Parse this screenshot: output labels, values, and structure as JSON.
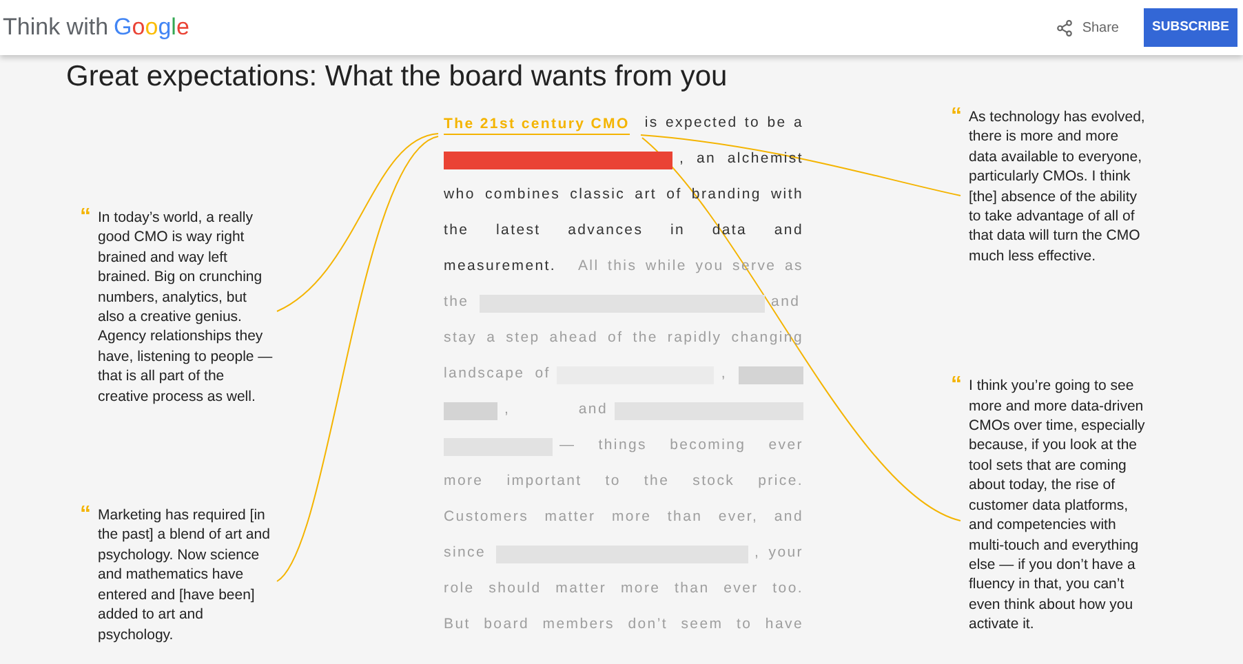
{
  "header": {
    "brand_prefix": "Think with",
    "brand": "Google",
    "share": "Share",
    "subscribe": "SUBSCRIBE"
  },
  "title": "Great expectations: What the board wants from you",
  "left_quotes": [
    {
      "mark": "“",
      "text": "In today’s world, a really good CMO is way right brained and way left brained. Big on crunching numbers, analytics, but also a creative genius. Agency relationships they have, listening to people — that is all part of the creative process as well."
    },
    {
      "mark": "“",
      "text": "Marketing has required [in the past] a blend of art and psychology. Now science and mathematics have entered and [have been] added to art and psychology."
    }
  ],
  "right_quotes": [
    {
      "mark": "“",
      "text": "As technology has evolved, there is more and more data available to everyone, particularly CMOs. I think [the] absence of the ability to take advantage of all of that data will turn the CMO much less effective."
    },
    {
      "mark": "“",
      "text": "I think you’re going to see more and more data-driven CMOs over time, especially because, if you look at the tool sets that are coming about today, the rise of customer data platforms, and competencies with multi-touch and everything else — if you don’t have a fluency in that, you can’t even think about how you activate it."
    }
  ],
  "paragraph": [
    [
      {
        "kind": "link",
        "text": "The 21st century CMO"
      },
      {
        "kind": "text",
        "faded": false,
        "text": "is expected to be a"
      }
    ],
    [
      {
        "kind": "bar",
        "color": "#ea4335"
      },
      {
        "kind": "text",
        "faded": false,
        "text": ", an alchemist"
      }
    ],
    [
      {
        "kind": "text",
        "faded": false,
        "text": "who combines classic art of branding with"
      }
    ],
    [
      {
        "kind": "text",
        "faded": false,
        "text": "the latest advances in data and"
      }
    ],
    [
      {
        "kind": "text",
        "faded": false,
        "text": "measurement."
      },
      {
        "kind": "text",
        "faded": true,
        "text": "All this while you serve as"
      }
    ],
    [
      {
        "kind": "text",
        "faded": true,
        "text": "the"
      },
      {
        "kind": "bar",
        "color": "#e2e2e2"
      },
      {
        "kind": "text",
        "faded": true,
        "text": "and"
      }
    ],
    [
      {
        "kind": "text",
        "faded": true,
        "text": "stay a step ahead of the rapidly changing"
      }
    ],
    [
      {
        "kind": "text",
        "faded": true,
        "text": "landscape of"
      },
      {
        "kind": "bar",
        "color": "#ebebeb"
      },
      {
        "kind": "text",
        "faded": true,
        "text": ","
      },
      {
        "kind": "bar",
        "color": "#d4d4d4"
      }
    ],
    [
      {
        "kind": "bar",
        "color": "#d4d4d4"
      },
      {
        "kind": "text",
        "faded": true,
        "text": ", and"
      },
      {
        "kind": "bar",
        "color": "#e2e2e2"
      }
    ],
    [
      {
        "kind": "bar",
        "color": "#e2e2e2"
      },
      {
        "kind": "text",
        "faded": true,
        "text": "— things becoming ever"
      }
    ],
    [
      {
        "kind": "text",
        "faded": true,
        "text": "more important to the stock price."
      }
    ],
    [
      {
        "kind": "text",
        "faded": true,
        "text": "Customers matter more than ever, and"
      }
    ],
    [
      {
        "kind": "text",
        "faded": true,
        "text": "since"
      },
      {
        "kind": "bar",
        "color": "#e2e2e2"
      },
      {
        "kind": "text",
        "faded": true,
        "text": ", your"
      }
    ],
    [
      {
        "kind": "text",
        "faded": true,
        "text": "role should matter more than ever too."
      }
    ],
    [
      {
        "kind": "text",
        "faded": true,
        "text": "But board members don’t seem to have"
      }
    ]
  ]
}
